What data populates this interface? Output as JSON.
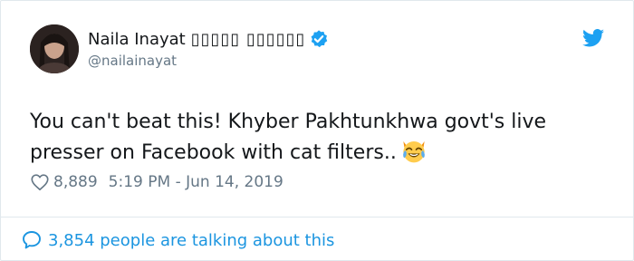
{
  "user": {
    "display_name": "Naila Inayat",
    "urdu_name": "▯▯▯▯▯ ▯▯▯▯▯▯",
    "handle": "@nailainayat"
  },
  "tweet": {
    "text": "You can't beat this! Khyber Pakhtunkhwa govt's live presser on Facebook with cat filters..",
    "emoji": "cat-face-with-tears-of-joy"
  },
  "meta": {
    "likes": "8,889",
    "timestamp": "5:19 PM - Jun 14, 2019"
  },
  "footer": {
    "talking": "3,854 people are talking about this"
  },
  "colors": {
    "accent": "#1da1f2",
    "link": "#1b95e0",
    "muted": "#657786",
    "border": "#e1e8ed"
  }
}
